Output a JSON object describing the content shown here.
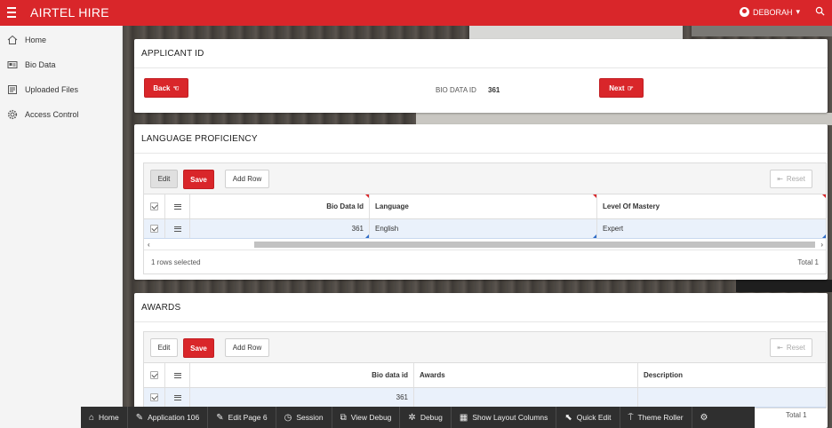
{
  "app": {
    "title": "AIRTEL HIRE",
    "user": "DEBORAH",
    "brand_color": "#d9262a"
  },
  "sidebar": {
    "items": [
      {
        "label": "Home",
        "icon": "home-icon"
      },
      {
        "label": "Bio Data",
        "icon": "id-card-icon"
      },
      {
        "label": "Uploaded Files",
        "icon": "file-icon"
      },
      {
        "label": "Access Control",
        "icon": "gear-icon"
      }
    ]
  },
  "applicant": {
    "title": "APPLICANT ID",
    "back_label": "Back",
    "next_label": "Next",
    "bio_label": "BIO DATA ID",
    "bio_value": "361"
  },
  "language": {
    "title": "LANGUAGE PROFICIENCY",
    "edit_label": "Edit",
    "save_label": "Save",
    "add_row_label": "Add Row",
    "reset_label": "Reset",
    "columns": [
      "Bio Data Id",
      "Language",
      "Level Of Mastery"
    ],
    "rows": [
      {
        "bio_id": "361",
        "language": "English",
        "level": "Expert"
      }
    ],
    "selected_text": "1 rows selected",
    "total_text": "Total 1"
  },
  "awards": {
    "title": "AWARDS",
    "edit_label": "Edit",
    "save_label": "Save",
    "add_row_label": "Add Row",
    "reset_label": "Reset",
    "columns": [
      "Bio data id",
      "Awards",
      "Description"
    ],
    "rows": [
      {
        "bio_id": "361",
        "awards": "",
        "description": ""
      }
    ],
    "total_text": "Total 1"
  },
  "devbar": {
    "items": [
      "Home",
      "Application 106",
      "Edit Page 6",
      "Session",
      "View Debug",
      "Debug",
      "Show Layout Columns",
      "Quick Edit",
      "Theme Roller"
    ]
  }
}
